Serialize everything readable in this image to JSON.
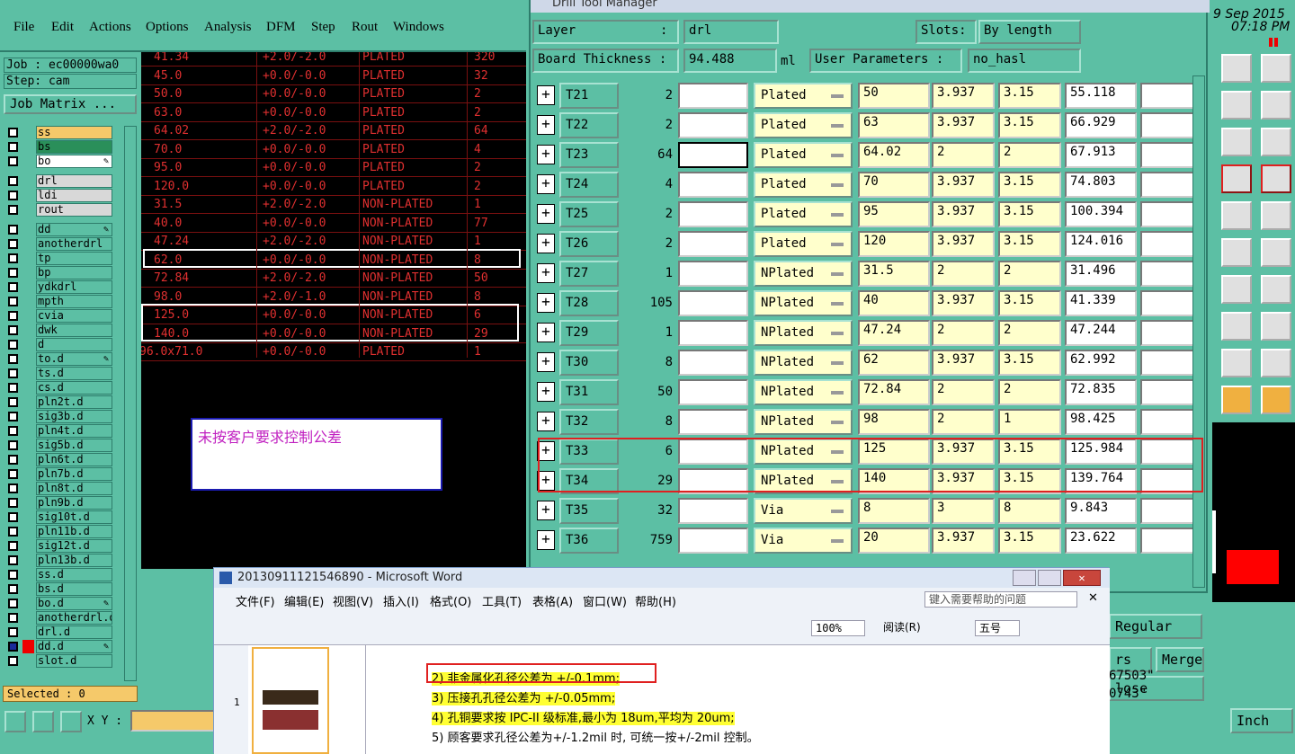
{
  "menu": {
    "items": [
      "File",
      "Edit",
      "Actions",
      "Options",
      "Analysis",
      "DFM",
      "Step",
      "Rout",
      "Windows"
    ]
  },
  "job": {
    "job_label": "Job : ec00000wa0",
    "step_label": "Step: cam",
    "matrix_button": "Job Matrix ..."
  },
  "layers": [
    {
      "name": "ss",
      "color": "#f5c96a"
    },
    {
      "name": "bs",
      "color": "#2a8f5a"
    },
    {
      "name": "bo",
      "color": "#ffffff",
      "mark": "✎"
    },
    {
      "name": "drl",
      "color": "#d8d8d8"
    },
    {
      "name": "ldi",
      "color": "#d8d8d8"
    },
    {
      "name": "rout",
      "color": "#d8d8d8"
    },
    {
      "name": "dd",
      "mark": "✎"
    },
    {
      "name": "anotherdrl"
    },
    {
      "name": "tp"
    },
    {
      "name": "bp"
    },
    {
      "name": "ydkdrl"
    },
    {
      "name": "mpth"
    },
    {
      "name": "cvia"
    },
    {
      "name": "dwk"
    },
    {
      "name": "d"
    },
    {
      "name": "to.d",
      "mark": "✎"
    },
    {
      "name": "ts.d"
    },
    {
      "name": "cs.d"
    },
    {
      "name": "pln2t.d"
    },
    {
      "name": "sig3b.d"
    },
    {
      "name": "pln4t.d"
    },
    {
      "name": "sig5b.d"
    },
    {
      "name": "pln6t.d"
    },
    {
      "name": "pln7b.d"
    },
    {
      "name": "pln8t.d"
    },
    {
      "name": "pln9b.d"
    },
    {
      "name": "sig10t.d"
    },
    {
      "name": "pln11b.d"
    },
    {
      "name": "sig12t.d"
    },
    {
      "name": "pln13b.d"
    },
    {
      "name": "ss.d"
    },
    {
      "name": "bs.d"
    },
    {
      "name": "bo.d",
      "mark": "✎"
    },
    {
      "name": "anotherdrl.d"
    },
    {
      "name": "drl.d"
    },
    {
      "name": "dd.d",
      "mark": "✎"
    },
    {
      "name": "slot.d"
    }
  ],
  "selected_label": "Selected : 0",
  "xy_label": "X Y :",
  "canvas_rows": [
    {
      "size": "41.34",
      "tol": "+2.0/-2.0",
      "type": "PLATED",
      "count": "320"
    },
    {
      "size": "45.0",
      "tol": "+0.0/-0.0",
      "type": "PLATED",
      "count": "32"
    },
    {
      "size": "50.0",
      "tol": "+0.0/-0.0",
      "type": "PLATED",
      "count": "2"
    },
    {
      "size": "63.0",
      "tol": "+0.0/-0.0",
      "type": "PLATED",
      "count": "2"
    },
    {
      "size": "64.02",
      "tol": "+2.0/-2.0",
      "type": "PLATED",
      "count": "64"
    },
    {
      "size": "70.0",
      "tol": "+0.0/-0.0",
      "type": "PLATED",
      "count": "4"
    },
    {
      "size": "95.0",
      "tol": "+0.0/-0.0",
      "type": "PLATED",
      "count": "2"
    },
    {
      "size": "120.0",
      "tol": "+0.0/-0.0",
      "type": "PLATED",
      "count": "2"
    },
    {
      "size": "31.5",
      "tol": "+2.0/-2.0",
      "type": "NON-PLATED",
      "count": "1"
    },
    {
      "size": "40.0",
      "tol": "+0.0/-0.0",
      "type": "NON-PLATED",
      "count": "77"
    },
    {
      "size": "47.24",
      "tol": "+2.0/-2.0",
      "type": "NON-PLATED",
      "count": "1"
    },
    {
      "size": "62.0",
      "tol": "+0.0/-0.0",
      "type": "NON-PLATED",
      "count": "8"
    },
    {
      "size": "72.84",
      "tol": "+2.0/-2.0",
      "type": "NON-PLATED",
      "count": "50"
    },
    {
      "size": "98.0",
      "tol": "+2.0/-1.0",
      "type": "NON-PLATED",
      "count": "8"
    },
    {
      "size": "125.0",
      "tol": "+0.0/-0.0",
      "type": "NON-PLATED",
      "count": "6"
    },
    {
      "size": "140.0",
      "tol": "+0.0/-0.0",
      "type": "NON-PLATED",
      "count": "29"
    },
    {
      "size": "96.0x71.0",
      "tol": "+0.0/-0.0",
      "type": "PLATED",
      "count": "1"
    }
  ],
  "note_text": "未按客户要求控制公差",
  "dtm": {
    "title": "Drill Tool Manager",
    "layer_label": "Layer",
    "layer_colon": ":",
    "layer_value": "drl",
    "slots_label": "Slots:",
    "slots_value": "By length",
    "thickness_label": "Board Thickness :",
    "thickness_value": "94.488",
    "thickness_unit": "ml",
    "user_params_label": "User Parameters :",
    "user_params_value": "no_hasl",
    "rows": [
      {
        "tool": "T21",
        "count": "2",
        "type": "Plated",
        "c1": "50",
        "c2": "3.937",
        "c3": "3.15",
        "c4": "55.118"
      },
      {
        "tool": "T22",
        "count": "2",
        "type": "Plated",
        "c1": "63",
        "c2": "3.937",
        "c3": "3.15",
        "c4": "66.929"
      },
      {
        "tool": "T23",
        "count": "64",
        "type": "Plated",
        "c1": "64.02",
        "c2": "2",
        "c3": "2",
        "c4": "67.913"
      },
      {
        "tool": "T24",
        "count": "4",
        "type": "Plated",
        "c1": "70",
        "c2": "3.937",
        "c3": "3.15",
        "c4": "74.803"
      },
      {
        "tool": "T25",
        "count": "2",
        "type": "Plated",
        "c1": "95",
        "c2": "3.937",
        "c3": "3.15",
        "c4": "100.394"
      },
      {
        "tool": "T26",
        "count": "2",
        "type": "Plated",
        "c1": "120",
        "c2": "3.937",
        "c3": "3.15",
        "c4": "124.016"
      },
      {
        "tool": "T27",
        "count": "1",
        "type": "NPlated",
        "c1": "31.5",
        "c2": "2",
        "c3": "2",
        "c4": "31.496"
      },
      {
        "tool": "T28",
        "count": "105",
        "type": "NPlated",
        "c1": "40",
        "c2": "3.937",
        "c3": "3.15",
        "c4": "41.339"
      },
      {
        "tool": "T29",
        "count": "1",
        "type": "NPlated",
        "c1": "47.24",
        "c2": "2",
        "c3": "2",
        "c4": "47.244"
      },
      {
        "tool": "T30",
        "count": "8",
        "type": "NPlated",
        "c1": "62",
        "c2": "3.937",
        "c3": "3.15",
        "c4": "62.992"
      },
      {
        "tool": "T31",
        "count": "50",
        "type": "NPlated",
        "c1": "72.84",
        "c2": "2",
        "c3": "2",
        "c4": "72.835"
      },
      {
        "tool": "T32",
        "count": "8",
        "type": "NPlated",
        "c1": "98",
        "c2": "2",
        "c3": "1",
        "c4": "98.425"
      },
      {
        "tool": "T33",
        "count": "6",
        "type": "NPlated",
        "c1": "125",
        "c2": "3.937",
        "c3": "3.15",
        "c4": "125.984"
      },
      {
        "tool": "T34",
        "count": "29",
        "type": "NPlated",
        "c1": "140",
        "c2": "3.937",
        "c3": "3.15",
        "c4": "139.764"
      },
      {
        "tool": "T35",
        "count": "32",
        "type": "Via",
        "c1": "8",
        "c2": "3",
        "c3": "8",
        "c4": "9.843"
      },
      {
        "tool": "T36",
        "count": "759",
        "type": "Via",
        "c1": "20",
        "c2": "3.937",
        "c3": "3.15",
        "c4": "23.622"
      }
    ]
  },
  "clock": {
    "date": "9 Sep 2015",
    "time": "07:18 PM"
  },
  "word": {
    "title": "20130911121546890 - Microsoft Word",
    "menu": [
      "文件(F)",
      "编辑(E)",
      "视图(V)",
      "插入(I)",
      "格式(O)",
      "工具(T)",
      "表格(A)",
      "窗口(W)",
      "帮助(H)"
    ],
    "help_placeholder": "键入需要帮助的问题",
    "zoom": "100%",
    "read_label": "阅读(R)",
    "font_size": "五号",
    "page_number": "1",
    "lines": [
      "2) 非金属化孔径公差为 +/-0.1mm;",
      "3) 压接孔孔径公差为 +/-0.05mm;",
      "4) 孔铜要求按 IPC-II 级标准,最小为 18um,平均为 20um;",
      "5) 顾客要求孔径公差为+/-1.2mil 时, 可统一按+/-2mil 控制。"
    ]
  },
  "bottom_right": {
    "regular": "Regular",
    "merge": "Merge",
    "rs": "rs",
    "close": "lose",
    "coord1": "67503\"",
    "coord2": "0743\"",
    "units": "Inch"
  }
}
